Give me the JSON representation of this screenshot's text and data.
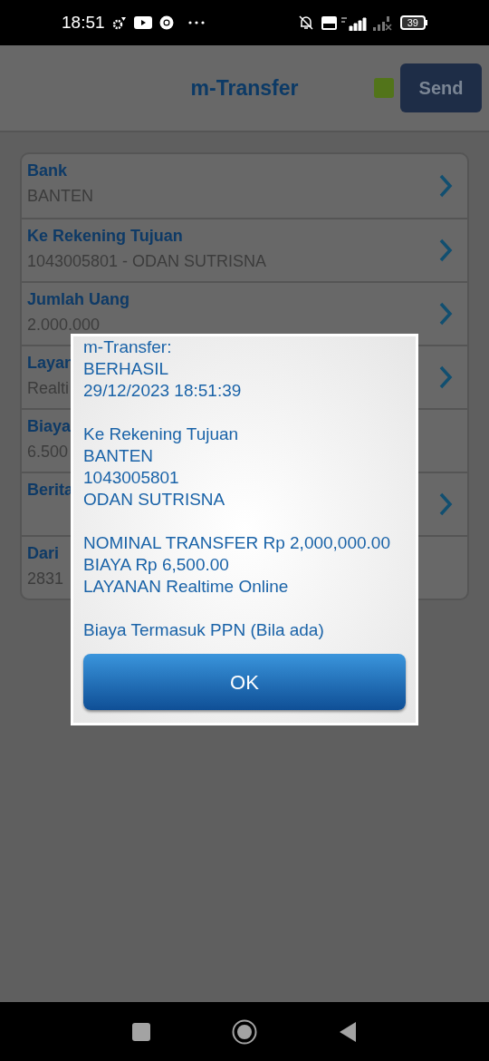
{
  "status_bar": {
    "time": "18:51",
    "battery": "39"
  },
  "header": {
    "title": "m-Transfer",
    "send_button": "Send"
  },
  "form_rows": [
    {
      "label": "Bank",
      "value": "BANTEN",
      "arrow": true
    },
    {
      "label": "Ke Rekening Tujuan",
      "value": "1043005801 - ODAN SUTRISNA",
      "arrow": true
    },
    {
      "label": "Jumlah Uang",
      "value": "2.000.000",
      "arrow": true
    },
    {
      "label": "Layan",
      "value": "Realti",
      "arrow": true
    },
    {
      "label": "Biaya",
      "value": "6.500",
      "arrow": false
    },
    {
      "label": "Berita",
      "arrow": true
    },
    {
      "label": "Dari",
      "value": "2831",
      "arrow": false
    }
  ],
  "dialog": {
    "message_groups": [
      [
        "m-Transfer:",
        "BERHASIL",
        "29/12/2023 18:51:39"
      ],
      [
        "Ke Rekening Tujuan",
        "BANTEN",
        "1043005801",
        "ODAN SUTRISNA"
      ],
      [
        "NOMINAL TRANSFER Rp 2,000,000.00",
        "BIAYA Rp 6,500.00",
        "LAYANAN Realtime Online"
      ],
      [
        "Biaya Termasuk PPN (Bila ada)"
      ]
    ],
    "ok_button": "OK"
  }
}
